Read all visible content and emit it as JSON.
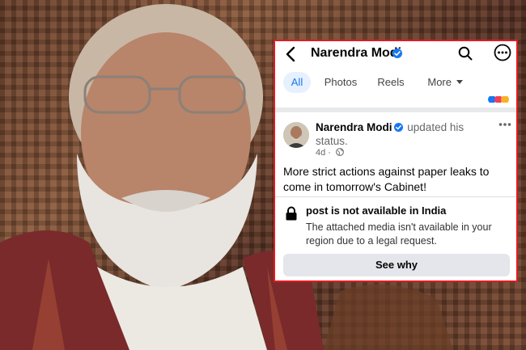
{
  "header": {
    "profile_name": "Narendra Modi"
  },
  "tabs": [
    {
      "label": "All"
    },
    {
      "label": "Photos"
    },
    {
      "label": "Reels"
    },
    {
      "label": "More"
    }
  ],
  "post": {
    "author": "Narendra Modi",
    "action": "updated his status.",
    "time": "4d",
    "text": "More strict actions against paper leaks to come in tomorrow's Cabinet!"
  },
  "notice": {
    "title": "post is not available in India",
    "body": "The attached media isn't available in your region due to a legal request.",
    "button_label": "See why"
  },
  "colors": {
    "accent": "#1877f2",
    "border": "#e11b22"
  }
}
